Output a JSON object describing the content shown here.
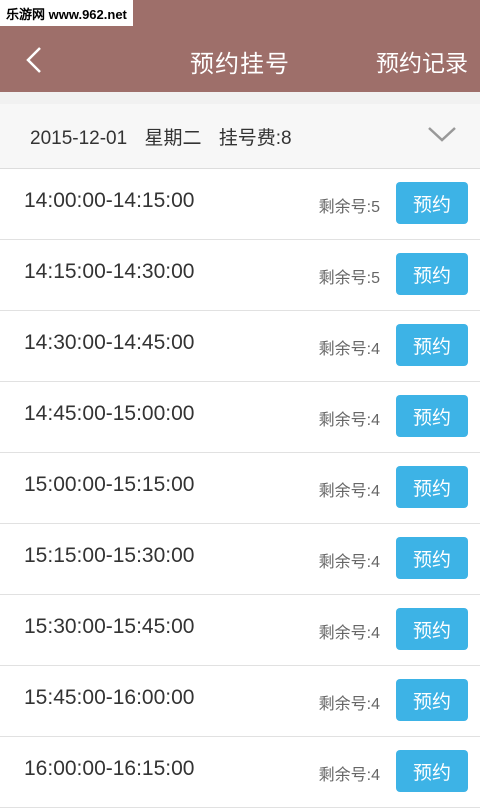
{
  "watermark": "乐游网 www.962.net",
  "header": {
    "title": "预约挂号",
    "records_label": "预约记录"
  },
  "date_bar": {
    "date": "2015-12-01",
    "weekday": "星期二",
    "fee": "挂号费:8"
  },
  "slots": [
    {
      "time": "14:00:00-14:15:00",
      "remaining": "剩余号:5",
      "button": "预约"
    },
    {
      "time": "14:15:00-14:30:00",
      "remaining": "剩余号:5",
      "button": "预约"
    },
    {
      "time": "14:30:00-14:45:00",
      "remaining": "剩余号:4",
      "button": "预约"
    },
    {
      "time": "14:45:00-15:00:00",
      "remaining": "剩余号:4",
      "button": "预约"
    },
    {
      "time": "15:00:00-15:15:00",
      "remaining": "剩余号:4",
      "button": "预约"
    },
    {
      "time": "15:15:00-15:30:00",
      "remaining": "剩余号:4",
      "button": "预约"
    },
    {
      "time": "15:30:00-15:45:00",
      "remaining": "剩余号:4",
      "button": "预约"
    },
    {
      "time": "15:45:00-16:00:00",
      "remaining": "剩余号:4",
      "button": "预约"
    },
    {
      "time": "16:00:00-16:15:00",
      "remaining": "剩余号:4",
      "button": "预约"
    }
  ],
  "colors": {
    "header": "#9e6f6a",
    "accent": "#3db3e6"
  }
}
